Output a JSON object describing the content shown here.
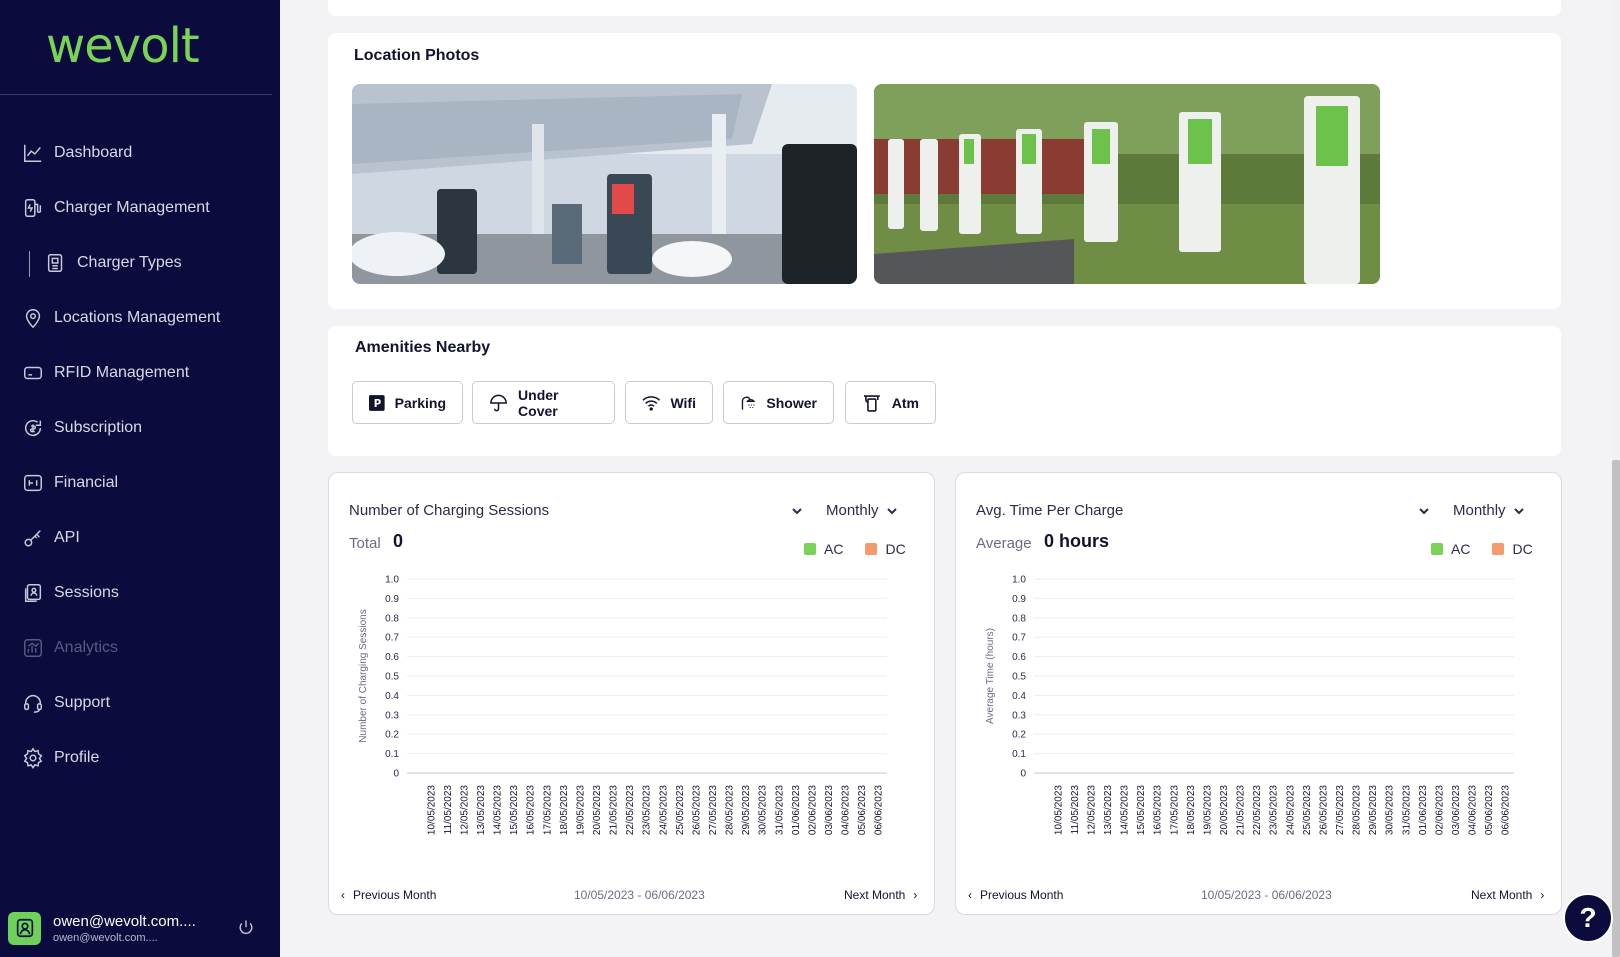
{
  "brand": {
    "logo": "wevolt"
  },
  "sidebar": {
    "items": [
      {
        "label": "Dashboard",
        "icon": "chart-line-icon"
      },
      {
        "label": "Charger Management",
        "icon": "charger-icon"
      },
      {
        "label": "Charger Types",
        "icon": "charger-types-icon"
      },
      {
        "label": "Locations Management",
        "icon": "location-pin-icon"
      },
      {
        "label": "RFID Management",
        "icon": "rfid-card-icon"
      },
      {
        "label": "Subscription",
        "icon": "subscription-icon"
      },
      {
        "label": "Financial",
        "icon": "wallet-icon"
      },
      {
        "label": "API",
        "icon": "key-icon"
      },
      {
        "label": "Sessions",
        "icon": "sessions-icon"
      },
      {
        "label": "Analytics",
        "icon": "analytics-icon"
      },
      {
        "label": "Support",
        "icon": "headset-icon"
      },
      {
        "label": "Profile",
        "icon": "gear-icon"
      }
    ],
    "user": {
      "name": "owen@wevolt.com....",
      "email": "owen@wevolt.com...."
    }
  },
  "photos": {
    "title": "Location Photos"
  },
  "amenities": {
    "title": "Amenities Nearby",
    "items": [
      {
        "label": "Parking",
        "icon": "parking-icon"
      },
      {
        "label": "Under Cover",
        "icon": "umbrella-icon"
      },
      {
        "label": "Wifi",
        "icon": "wifi-icon"
      },
      {
        "label": "Shower",
        "icon": "shower-icon"
      },
      {
        "label": "Atm",
        "icon": "atm-icon"
      }
    ]
  },
  "charts": [
    {
      "title": "Number of Charging Sessions",
      "period": "Monthly",
      "stat_label": "Total",
      "stat_value": "0",
      "legend": [
        "AC",
        "DC"
      ],
      "prev": "Previous Month",
      "next": "Next Month",
      "range": "10/05/2023 - 06/06/2023"
    },
    {
      "title": "Avg. Time Per Charge",
      "period": "Monthly",
      "stat_label": "Average",
      "stat_value": "0 hours",
      "legend": [
        "AC",
        "DC"
      ],
      "prev": "Previous Month",
      "next": "Next Month",
      "range": "10/05/2023 - 06/06/2023"
    }
  ],
  "colors": {
    "ac": "#7ad357",
    "dc": "#f59a6a",
    "sidebar": "#0c0b3e"
  },
  "chart_data": [
    {
      "type": "bar",
      "ylabel": "Number of Charging Sessions",
      "ylim": [
        0,
        1
      ],
      "yticks": [
        "1.0",
        "0.9",
        "0.8",
        "0.7",
        "0.6",
        "0.5",
        "0.4",
        "0.3",
        "0.2",
        "0.1",
        "0"
      ],
      "categories": [
        "10/05/2023",
        "11/05/2023",
        "12/05/2023",
        "13/05/2023",
        "14/05/2023",
        "15/05/2023",
        "16/05/2023",
        "17/05/2023",
        "18/05/2023",
        "19/05/2023",
        "20/05/2023",
        "21/05/2023",
        "22/05/2023",
        "23/05/2023",
        "24/05/2023",
        "25/05/2023",
        "26/05/2023",
        "27/05/2023",
        "28/05/2023",
        "29/05/2023",
        "30/05/2023",
        "31/05/2023",
        "01/06/2023",
        "02/06/2023",
        "03/06/2023",
        "04/06/2023",
        "05/06/2023",
        "06/06/2023"
      ],
      "series": [
        {
          "name": "AC",
          "values": [
            0,
            0,
            0,
            0,
            0,
            0,
            0,
            0,
            0,
            0,
            0,
            0,
            0,
            0,
            0,
            0,
            0,
            0,
            0,
            0,
            0,
            0,
            0,
            0,
            0,
            0,
            0,
            0
          ]
        },
        {
          "name": "DC",
          "values": [
            0,
            0,
            0,
            0,
            0,
            0,
            0,
            0,
            0,
            0,
            0,
            0,
            0,
            0,
            0,
            0,
            0,
            0,
            0,
            0,
            0,
            0,
            0,
            0,
            0,
            0,
            0,
            0
          ]
        }
      ],
      "grid": true
    },
    {
      "type": "bar",
      "ylabel": "Average Time (hours)",
      "ylim": [
        0,
        1
      ],
      "yticks": [
        "1.0",
        "0.9",
        "0.8",
        "0.7",
        "0.6",
        "0.5",
        "0.4",
        "0.3",
        "0.2",
        "0.1",
        "0"
      ],
      "categories": [
        "10/05/2023",
        "11/05/2023",
        "12/05/2023",
        "13/05/2023",
        "14/05/2023",
        "15/05/2023",
        "16/05/2023",
        "17/05/2023",
        "18/05/2023",
        "19/05/2023",
        "20/05/2023",
        "21/05/2023",
        "22/05/2023",
        "23/05/2023",
        "24/05/2023",
        "25/05/2023",
        "26/05/2023",
        "27/05/2023",
        "28/05/2023",
        "29/05/2023",
        "30/05/2023",
        "31/05/2023",
        "01/06/2023",
        "02/06/2023",
        "03/06/2023",
        "04/06/2023",
        "05/06/2023",
        "06/06/2023"
      ],
      "series": [
        {
          "name": "AC",
          "values": [
            0,
            0,
            0,
            0,
            0,
            0,
            0,
            0,
            0,
            0,
            0,
            0,
            0,
            0,
            0,
            0,
            0,
            0,
            0,
            0,
            0,
            0,
            0,
            0,
            0,
            0,
            0,
            0
          ]
        },
        {
          "name": "DC",
          "values": [
            0,
            0,
            0,
            0,
            0,
            0,
            0,
            0,
            0,
            0,
            0,
            0,
            0,
            0,
            0,
            0,
            0,
            0,
            0,
            0,
            0,
            0,
            0,
            0,
            0,
            0,
            0,
            0
          ]
        }
      ],
      "grid": true
    }
  ],
  "help": {
    "label": "?"
  }
}
